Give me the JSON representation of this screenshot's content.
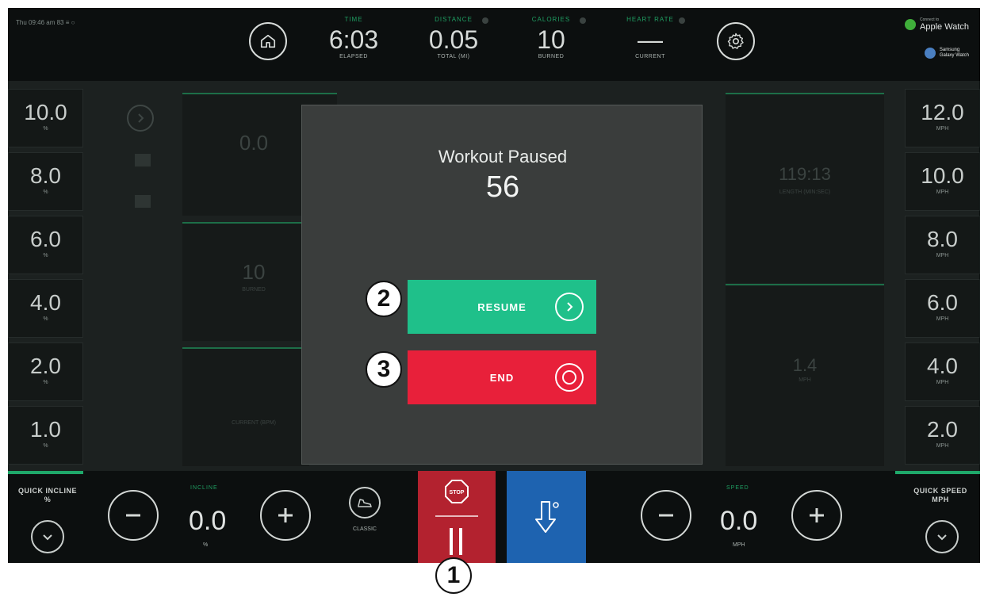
{
  "status_bar": {
    "datetime": "Thu 09:46 am  83 ≡ ○"
  },
  "top_stats": [
    {
      "label": "TIME",
      "value": "6:03",
      "sub": "ELAPSED"
    },
    {
      "label": "DISTANCE",
      "value": "0.05",
      "sub": "TOTAL (MI)"
    },
    {
      "label": "CALORIES",
      "value": "10",
      "sub": "BURNED"
    },
    {
      "label": "HEART RATE",
      "value": "—",
      "sub": "CURRENT"
    }
  ],
  "watches": {
    "apple": "Apple Watch",
    "apple_small": "Connect to",
    "samsung": "Samsung",
    "samsung_sub": "Galaxy Watch"
  },
  "incline_presets": [
    {
      "value": "10.0",
      "unit": "%"
    },
    {
      "value": "8.0",
      "unit": "%"
    },
    {
      "value": "6.0",
      "unit": "%"
    },
    {
      "value": "4.0",
      "unit": "%"
    },
    {
      "value": "2.0",
      "unit": "%"
    },
    {
      "value": "1.0",
      "unit": "%"
    }
  ],
  "speed_presets": [
    {
      "value": "12.0",
      "unit": "MPH"
    },
    {
      "value": "10.0",
      "unit": "MPH"
    },
    {
      "value": "8.0",
      "unit": "MPH"
    },
    {
      "value": "6.0",
      "unit": "MPH"
    },
    {
      "value": "4.0",
      "unit": "MPH"
    },
    {
      "value": "2.0",
      "unit": "MPH"
    }
  ],
  "background_panels": {
    "left1_value": "0.0",
    "left2_value": "10",
    "left2_sub": "BURNED",
    "left3_sub": "CURRENT (BPM)",
    "right1_value": "119:13",
    "right1_sub": "LENGTH (MIN:SEC)",
    "right2_value": "1.4",
    "right2_sub": "MPH"
  },
  "modal": {
    "title": "Workout Paused",
    "countdown": "56",
    "resume_label": "RESUME",
    "end_label": "END"
  },
  "bottom": {
    "quick_incline_label": "QUICK INCLINE",
    "quick_incline_unit": "%",
    "incline_label": "INCLINE",
    "incline_value": "0.0",
    "incline_unit": "%",
    "mode_label": "CLASSIC",
    "speed_label": "SPEED",
    "speed_value": "0.0",
    "speed_unit": "MPH",
    "quick_speed_label": "QUICK SPEED",
    "quick_speed_unit": "MPH",
    "stop_text": "STOP"
  },
  "callouts": {
    "c1": "1",
    "c2": "2",
    "c3": "3"
  },
  "colors": {
    "accent_green": "#1fc08a",
    "danger_red": "#e8203a",
    "stop_red": "#b3222f",
    "blue": "#1e63b0"
  }
}
